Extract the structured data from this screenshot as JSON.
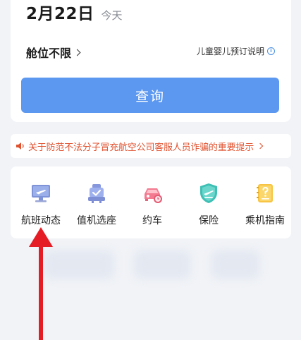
{
  "search": {
    "date": "2月22日",
    "day": "今天",
    "cabin": "舱位不限",
    "child_info": "儿童婴儿预订说明",
    "query_button": "查询"
  },
  "notice": {
    "text": "关于防范不法分子冒充航空公司客服人员诈骗的重要提示"
  },
  "services": [
    {
      "label": "航班动态",
      "icon": "flight-status-monitor-icon"
    },
    {
      "label": "值机选座",
      "icon": "checkin-seat-icon"
    },
    {
      "label": "约车",
      "icon": "car-booking-icon"
    },
    {
      "label": "保险",
      "icon": "insurance-shield-icon"
    },
    {
      "label": "乘机指南",
      "icon": "boarding-guide-icon"
    }
  ],
  "colors": {
    "accent": "#5c98ef",
    "notice": "#e0522f",
    "annotation_arrow": "#e51c24"
  }
}
